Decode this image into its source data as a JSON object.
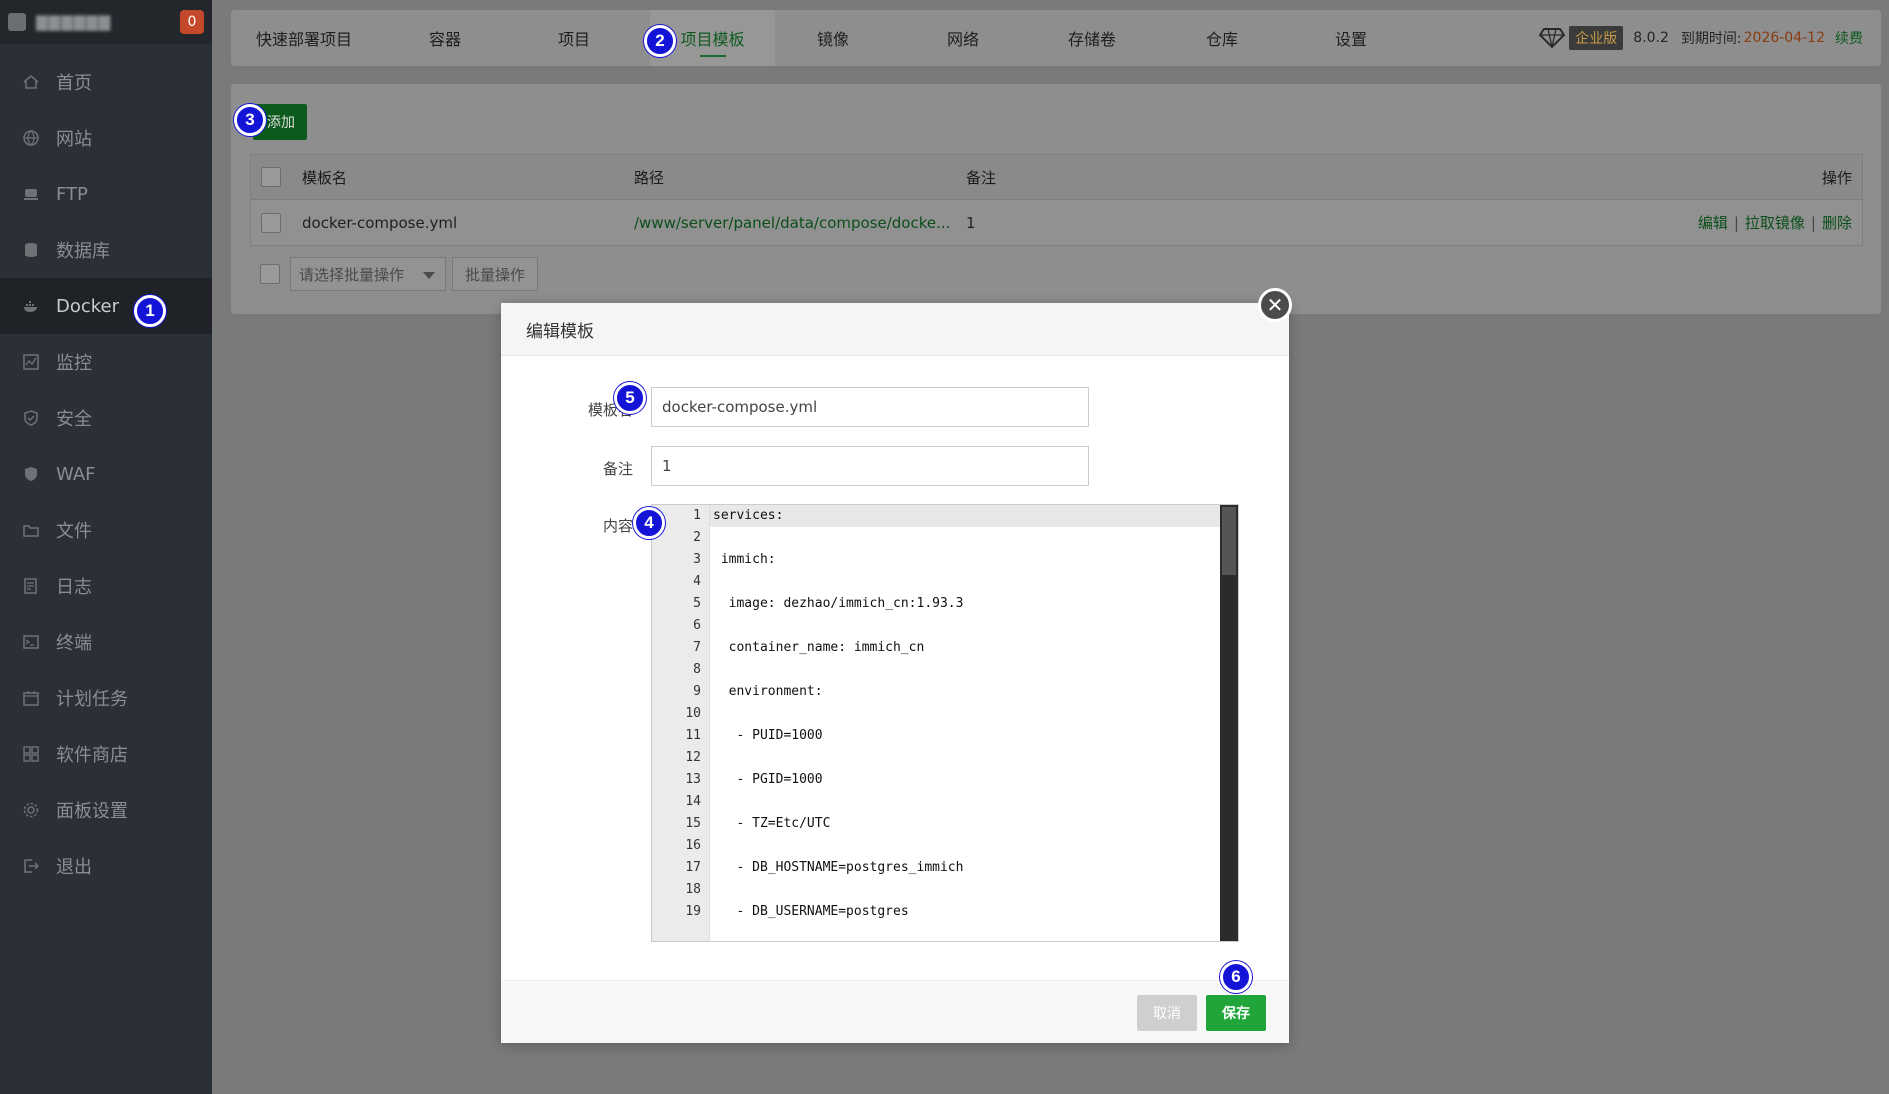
{
  "sidebar": {
    "host": "▇▇▇▇▇▇",
    "badge": "0",
    "items": [
      {
        "label": "首页",
        "icon": "home-icon"
      },
      {
        "label": "网站",
        "icon": "globe-icon"
      },
      {
        "label": "FTP",
        "icon": "ftp-icon"
      },
      {
        "label": "数据库",
        "icon": "database-icon"
      },
      {
        "label": "Docker",
        "icon": "docker-icon"
      },
      {
        "label": "监控",
        "icon": "monitor-icon"
      },
      {
        "label": "安全",
        "icon": "shield-icon"
      },
      {
        "label": "WAF",
        "icon": "waf-shield-icon"
      },
      {
        "label": "文件",
        "icon": "folder-icon"
      },
      {
        "label": "日志",
        "icon": "log-icon"
      },
      {
        "label": "终端",
        "icon": "terminal-icon"
      },
      {
        "label": "计划任务",
        "icon": "calendar-icon"
      },
      {
        "label": "软件商店",
        "icon": "apps-grid-icon"
      },
      {
        "label": "面板设置",
        "icon": "gear-icon"
      },
      {
        "label": "退出",
        "icon": "logout-icon"
      }
    ]
  },
  "topbar": {
    "tabs": [
      "快速部署项目",
      "容器",
      "项目",
      "项目模板",
      "镜像",
      "网络",
      "存储卷",
      "仓库",
      "设置"
    ],
    "active_tab": "项目模板",
    "edition": "企业版",
    "version": "8.0.2",
    "expire_label": "到期时间:",
    "expire_date": "2026-04-12",
    "renew": "续费"
  },
  "panel": {
    "add_label": "添加",
    "columns": {
      "name": "模板名",
      "path": "路径",
      "note": "备注",
      "ops": "操作"
    },
    "rows": [
      {
        "name": "docker-compose.yml",
        "path": "/www/server/panel/data/compose/docke...",
        "note": "1"
      }
    ],
    "ops": {
      "edit": "编辑",
      "pull": "拉取镜像",
      "delete": "删除"
    },
    "bulk_placeholder": "请选择批量操作",
    "bulk_button": "批量操作"
  },
  "modal": {
    "title": "编辑模板",
    "name_label": "模板名",
    "name_value": "docker-compose.yml",
    "note_label": "备注",
    "note_value": "1",
    "content_label": "内容",
    "lines": [
      "services:",
      "",
      " immich:",
      "",
      "  image: dezhao/immich_cn:1.93.3",
      "",
      "  container_name: immich_cn",
      "",
      "  environment:",
      "",
      "   - PUID=1000",
      "",
      "   - PGID=1000",
      "",
      "   - TZ=Etc/UTC",
      "",
      "   - DB_HOSTNAME=postgres_immich",
      "",
      "   - DB_USERNAME=postgres"
    ],
    "cancel": "取消",
    "save": "保存"
  },
  "markers": [
    "1",
    "2",
    "3",
    "4",
    "5",
    "6"
  ]
}
